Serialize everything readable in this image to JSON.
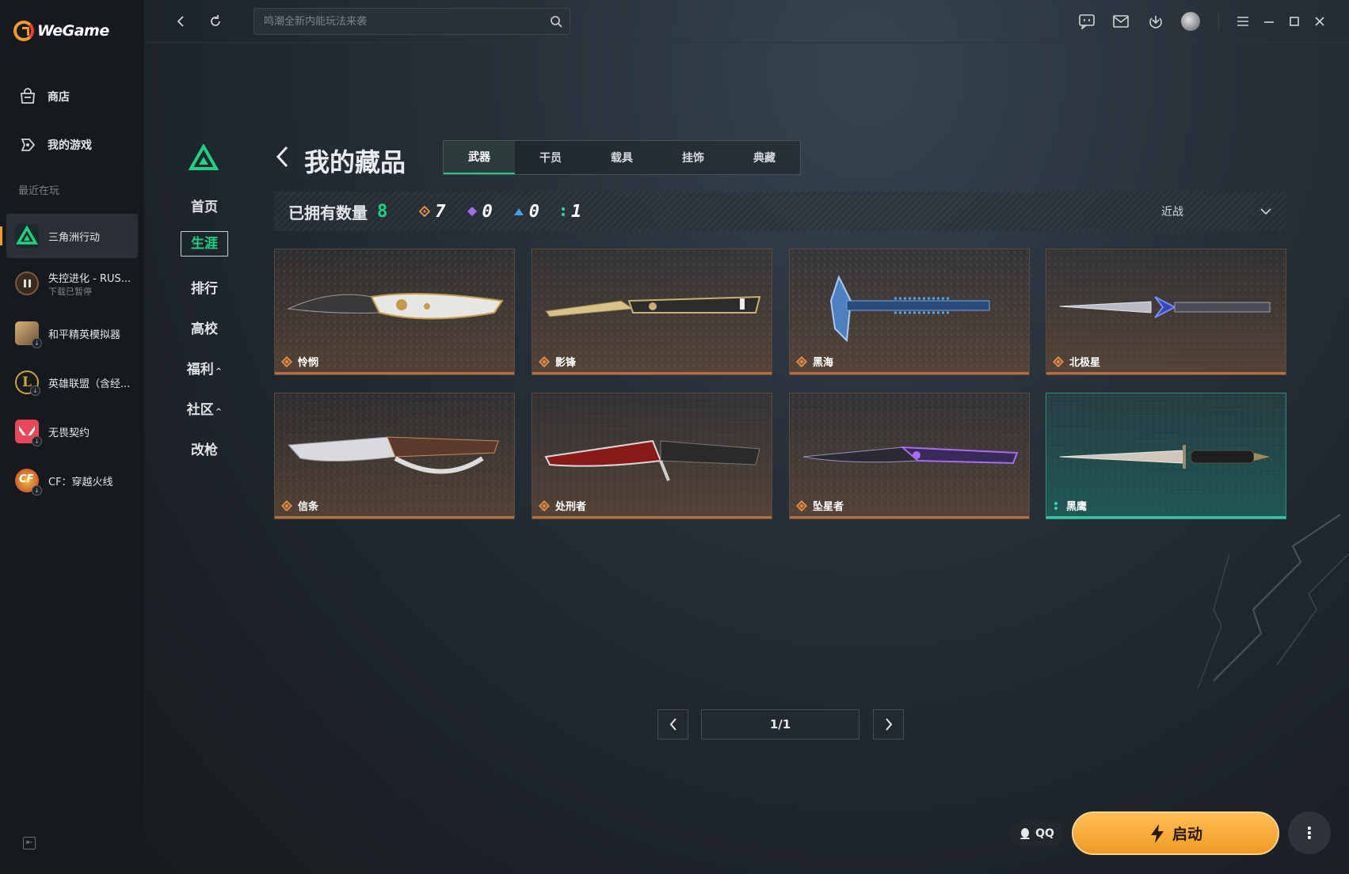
{
  "app": {
    "name": "WeGame"
  },
  "sidebar": {
    "nav": [
      {
        "label": "商店",
        "icon": "store-icon"
      },
      {
        "label": "我的游戏",
        "icon": "gamepad-icon"
      }
    ],
    "recent_label": "最近在玩",
    "games": [
      {
        "name": "三角洲行动",
        "active": true
      },
      {
        "name": "失控进化 - RUS...",
        "sub": "下载已暂停"
      },
      {
        "name": "和平精英模拟器"
      },
      {
        "name": "英雄联盟（含经..."
      },
      {
        "name": "无畏契约"
      },
      {
        "name": "CF：穿越火线"
      }
    ]
  },
  "search": {
    "placeholder": "鸣潮全新内能玩法来袭"
  },
  "game_nav": {
    "items": [
      "首页",
      "生涯",
      "排行",
      "高校",
      "福利",
      "社区",
      "改枪"
    ],
    "active": "生涯",
    "caret": "^"
  },
  "collection": {
    "title": "我的藏品",
    "tabs": [
      "武器",
      "干员",
      "载具",
      "挂饰",
      "典藏"
    ],
    "active_tab": "武器",
    "owned_label": "已拥有数量",
    "owned_total": "8",
    "rarity_counts": [
      {
        "icon": "orange-diamond-icon",
        "count": "7",
        "color": "#e08b4a"
      },
      {
        "icon": "purple-diamond-icon",
        "count": "0",
        "color": "#a46cf0"
      },
      {
        "icon": "blue-triangle-icon",
        "count": "0",
        "color": "#4e9be8"
      },
      {
        "icon": "green-dots-icon",
        "count": "1",
        "color": "#33d6a8"
      }
    ],
    "sort": {
      "value": "近战"
    },
    "items": [
      {
        "name": "怜悯",
        "rarity": "orange"
      },
      {
        "name": "影锋",
        "rarity": "orange"
      },
      {
        "name": "黑海",
        "rarity": "orange"
      },
      {
        "name": "北极星",
        "rarity": "orange"
      },
      {
        "name": "信条",
        "rarity": "orange"
      },
      {
        "name": "处刑者",
        "rarity": "orange"
      },
      {
        "name": "坠星者",
        "rarity": "orange"
      },
      {
        "name": "黑鹰",
        "rarity": "green"
      }
    ],
    "pager": {
      "text": "1/1"
    }
  },
  "footer": {
    "qq_label": "QQ",
    "launch_label": "启动",
    "more_label": "⋮"
  },
  "colors": {
    "accent_green": "#1fd183",
    "launch_orange": "#f6a93b",
    "brand_orange": "#f29a2e"
  }
}
